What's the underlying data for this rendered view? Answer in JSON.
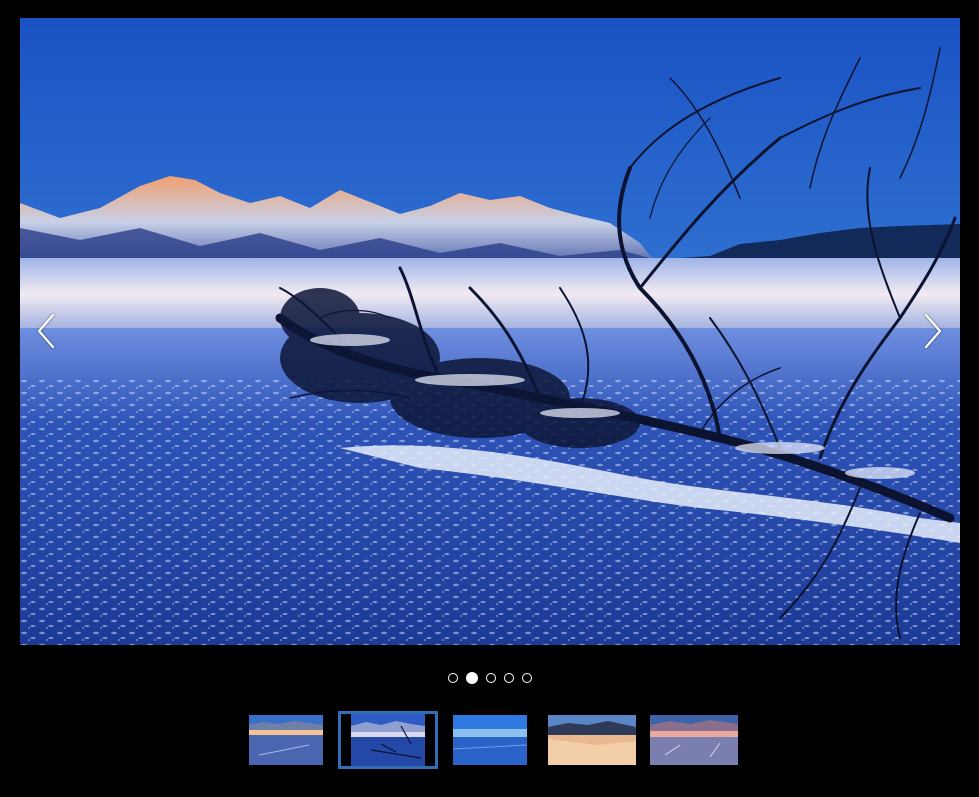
{
  "gallery": {
    "current_index": 1,
    "total": 5,
    "slides": [
      {
        "name": "slide-1"
      },
      {
        "name": "slide-2"
      },
      {
        "name": "slide-3"
      },
      {
        "name": "slide-4"
      },
      {
        "name": "slide-5"
      }
    ],
    "prev_icon": "chevron-left-icon",
    "next_icon": "chevron-right-icon",
    "colors": {
      "background": "#000000",
      "active_thumb_border": "#2f6db5",
      "dot": "#ffffff"
    }
  }
}
